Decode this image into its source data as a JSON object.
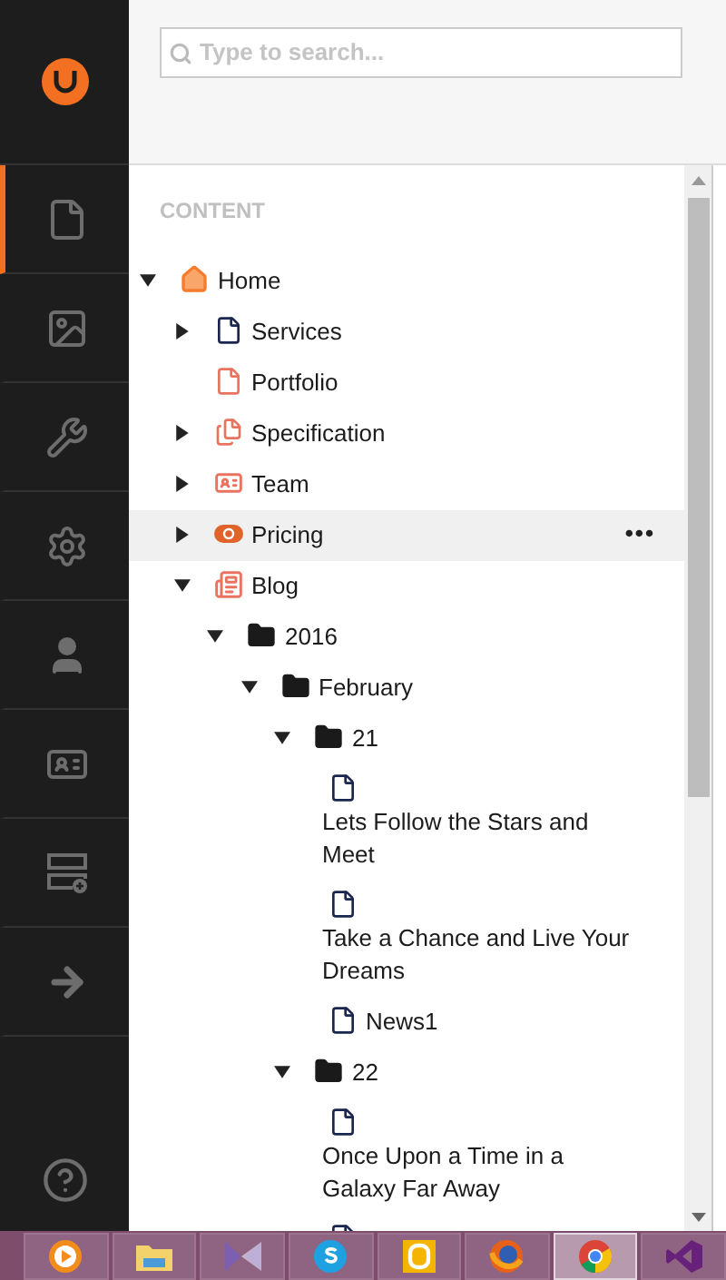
{
  "sidebar": {
    "items": [
      {
        "kind": "content",
        "selected": true
      },
      {
        "kind": "media",
        "selected": false
      },
      {
        "kind": "settings",
        "selected": false
      },
      {
        "kind": "developer",
        "selected": false
      },
      {
        "kind": "users",
        "selected": false
      },
      {
        "kind": "members",
        "selected": false
      },
      {
        "kind": "forms",
        "selected": false
      },
      {
        "kind": "redirect",
        "selected": false
      }
    ]
  },
  "search": {
    "placeholder": "Type to search..."
  },
  "tree": {
    "title": "CONTENT",
    "items": [
      {
        "label": "Home",
        "kind": "home",
        "expandable": true,
        "expanded": true,
        "highlighted": false,
        "children": [
          {
            "label": "Services",
            "kind": "doc",
            "expandable": true,
            "expanded": false,
            "highlighted": false
          },
          {
            "label": "Portfolio",
            "kind": "doc-orange",
            "expandable": false,
            "highlighted": false
          },
          {
            "label": "Specification",
            "kind": "docs",
            "expandable": true,
            "expanded": false,
            "highlighted": false
          },
          {
            "label": "Team",
            "kind": "team",
            "expandable": true,
            "expanded": false,
            "highlighted": false
          },
          {
            "label": "Pricing",
            "kind": "pricing",
            "expandable": true,
            "expanded": false,
            "highlighted": true,
            "actions": "•••"
          },
          {
            "label": "Blog",
            "kind": "blog",
            "expandable": true,
            "expanded": true,
            "highlighted": false,
            "children": [
              {
                "label": "2016",
                "kind": "folder",
                "expandable": true,
                "expanded": true,
                "highlighted": false,
                "children": [
                  {
                    "label": "February",
                    "kind": "folder",
                    "expandable": true,
                    "expanded": true,
                    "highlighted": false,
                    "children": [
                      {
                        "label": "21",
                        "kind": "folder",
                        "expandable": true,
                        "expanded": true,
                        "highlighted": false,
                        "children": [
                          {
                            "label": "Lets Follow the Stars and Meet",
                            "kind": "doc",
                            "expandable": false,
                            "highlighted": false
                          },
                          {
                            "label": "Take a Chance and Live Your Dreams",
                            "kind": "doc",
                            "expandable": false,
                            "highlighted": false
                          },
                          {
                            "label": "News1",
                            "kind": "doc",
                            "expandable": false,
                            "highlighted": false
                          }
                        ]
                      },
                      {
                        "label": "22",
                        "kind": "folder",
                        "expandable": true,
                        "expanded": true,
                        "highlighted": false,
                        "children": [
                          {
                            "label": "Once Upon a Time in a Galaxy Far Away",
                            "kind": "doc",
                            "expandable": false,
                            "highlighted": false
                          },
                          {
                            "kind": "doc",
                            "expandable": false,
                            "highlighted": false
                          }
                        ]
                      }
                    ]
                  }
                ]
              }
            ]
          }
        ]
      }
    ]
  },
  "taskbar": {
    "apps": [
      {
        "kind": "media-player",
        "selected": false
      },
      {
        "kind": "file-explorer",
        "selected": false
      },
      {
        "kind": "visual-studio-old",
        "selected": false
      },
      {
        "kind": "skype",
        "selected": false
      },
      {
        "kind": "outlook",
        "selected": false
      },
      {
        "kind": "firefox",
        "selected": false
      },
      {
        "kind": "chrome",
        "selected": true
      },
      {
        "kind": "visual-studio",
        "selected": false
      }
    ]
  }
}
